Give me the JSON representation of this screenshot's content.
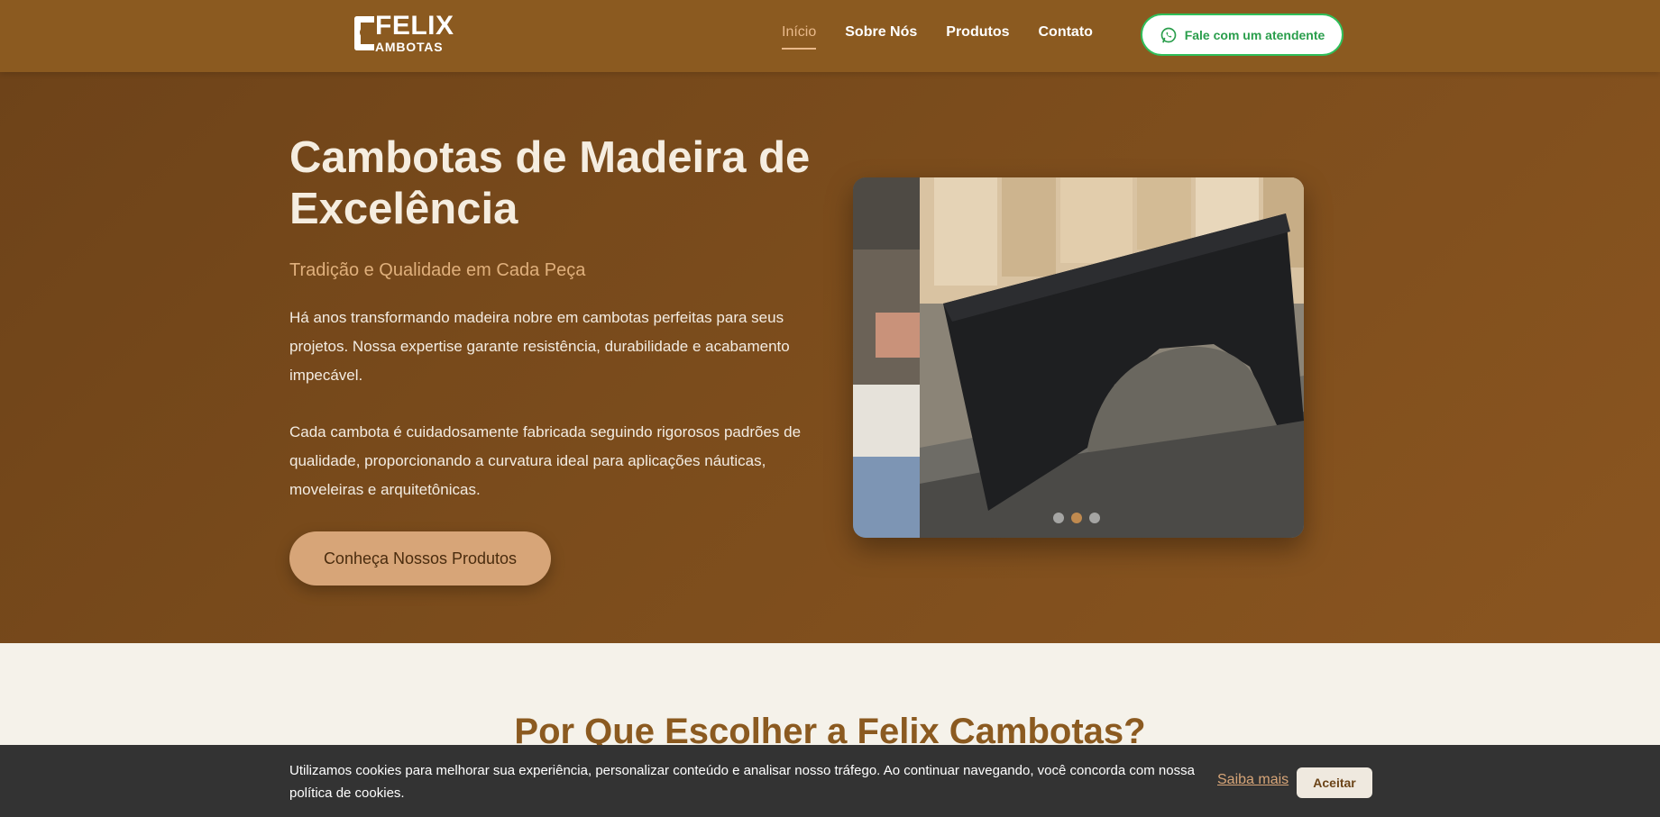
{
  "header": {
    "logo": {
      "line1": "FELIX",
      "line2": "AMBOTAS"
    },
    "nav": [
      {
        "label": "Início",
        "active": true
      },
      {
        "label": "Sobre Nós",
        "active": false
      },
      {
        "label": "Produtos",
        "active": false
      },
      {
        "label": "Contato",
        "active": false
      }
    ],
    "whatsapp_button": {
      "label": "Fale com um atendente",
      "icon": "whatsapp-icon"
    }
  },
  "hero": {
    "title": "Cambotas de Madeira de Excelência",
    "subtitle": "Tradição e Qualidade em Cada Peça",
    "paragraph1": "Há anos transformando madeira nobre em cambotas perfeitas para seus projetos. Nossa expertise garante resistência, durabilidade e acabamento impecável.",
    "paragraph2": "Cada cambota é cuidadosamente fabricada seguindo rigorosos padrões de qualidade, proporcionando a curvatura ideal para aplicações náuticas, moveleiras e arquitetônicas.",
    "cta_label": "Conheça Nossos Produtos",
    "carousel": {
      "slide_count": 3,
      "active_index": 1
    }
  },
  "why": {
    "title": "Por Que Escolher a Felix Cambotas?"
  },
  "cookie_bar": {
    "text": "Utilizamos cookies para melhorar sua experiência, personalizar conteúdo e analisar nosso tráfego. Ao continuar navegando, você concorda com nossa política de cookies.",
    "learn_more": "Saiba mais",
    "accept": "Aceitar"
  },
  "colors": {
    "header_bg": "#8b5a20",
    "accent": "#d7a578",
    "whatsapp_green": "#2fbf5a",
    "cookie_bg": "#333333"
  }
}
